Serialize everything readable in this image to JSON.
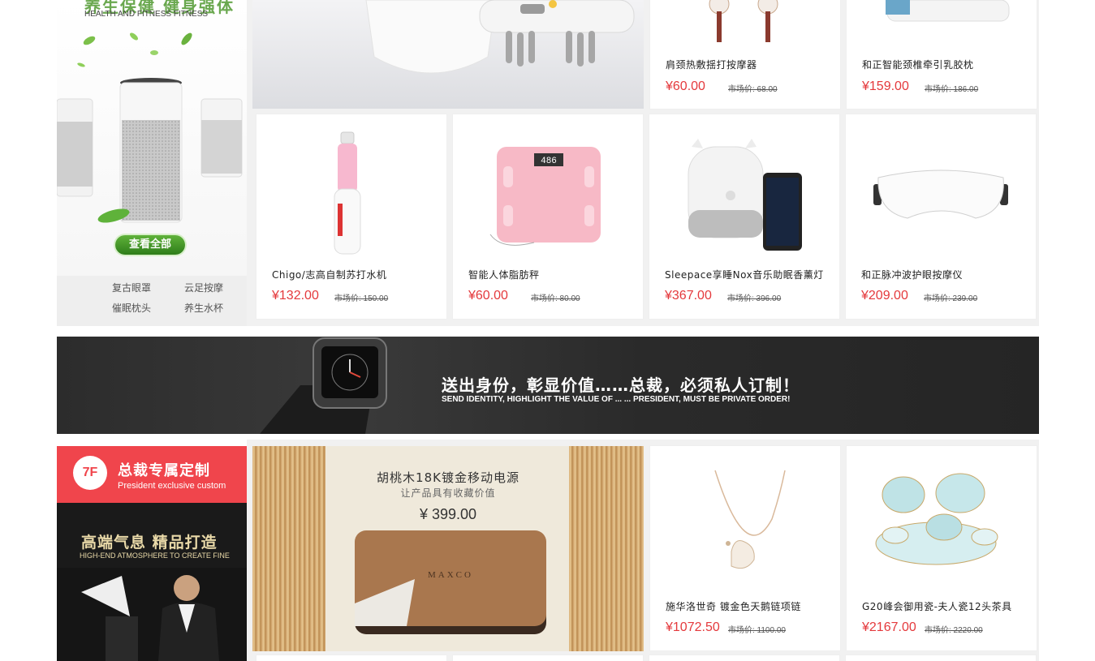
{
  "floor6": {
    "slogan_cn": "养生保健 健身强体",
    "slogan_en": "HEALTH AND FITNESS FITNESS",
    "view_all": "查看全部",
    "tags": [
      "复古眼罩",
      "云足按摩",
      "催眠枕头",
      "养生水杯"
    ],
    "top_products": [
      {
        "name": "肩颈热敷揺打按摩器",
        "price": "¥60.00",
        "market": "市场价: 68.00"
      },
      {
        "name": "和正智能颈椎牵引乳胶枕",
        "price": "¥159.00",
        "market": "市场价: 186.00"
      }
    ],
    "products": [
      {
        "name": "Chigo/志高自制苏打水机",
        "price": "¥132.00",
        "market": "市场价: 150.00"
      },
      {
        "name": "智能人体脂肪秤",
        "price": "¥60.00",
        "market": "市场价: 80.00"
      },
      {
        "name": "Sleepace享睡Nox音乐助眠香薰灯",
        "price": "¥367.00",
        "market": "市场价: 396.00"
      },
      {
        "name": "和正脉冲波护眼按摩仪",
        "price": "¥209.00",
        "market": "市场价: 239.00"
      }
    ],
    "scale_display": "486"
  },
  "ad": {
    "cn": "送出身份，彰显价值……总裁，必须私人订制！",
    "en": "SEND IDENTITY, HIGHLIGHT THE VALUE OF ... ... PRESIDENT, MUST BE PRIVATE ORDER!"
  },
  "floor7": {
    "badge": "7F",
    "title_cn": "总裁专属定制",
    "title_en": "President exclusive custom",
    "sub_cn": "高端气息 精品打造",
    "sub_en": "HIGH-END ATMOSPHERE TO CREATE FINE",
    "powerbank": {
      "title": "胡桃木18K镀金移动电源",
      "subtitle": "让产品具有收藏价值",
      "price": "¥ 399.00",
      "brand": "MAXCO"
    },
    "products": [
      {
        "name": "施华洛世奇 镀金色天鹅链项链",
        "price": "¥1072.50",
        "market": "市场价: 1100.00"
      },
      {
        "name": "G20峰会御用瓷-夫人瓷12头茶具",
        "price": "¥2167.00",
        "market": "市场价: 2220.00"
      }
    ]
  },
  "colors": {
    "price_red": "#e4393c",
    "floor_red": "#f0454c",
    "green": "#5fb23a"
  }
}
